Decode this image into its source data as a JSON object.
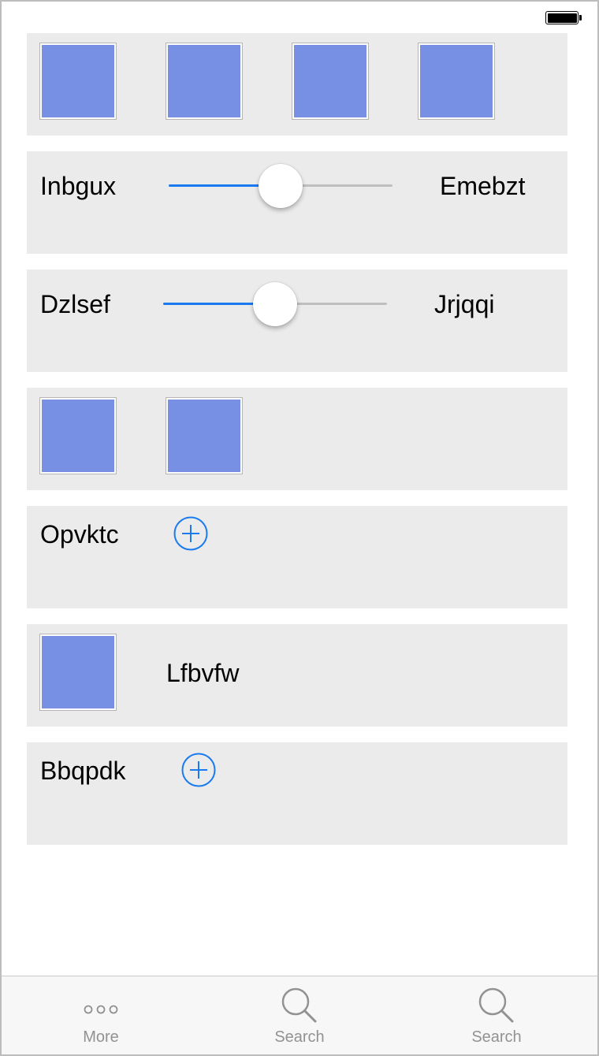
{
  "status_bar": {
    "battery_icon": "battery-full-icon"
  },
  "rows": {
    "row2": {
      "left_label": "Inbgux",
      "right_label": "Emebzt",
      "slider_value": 0.5
    },
    "row3": {
      "left_label": "Dzlsef",
      "right_label": "Jrjqqi",
      "slider_value": 0.5
    },
    "row5": {
      "label": "Opvktc",
      "button_icon": "plus-circle-icon"
    },
    "row6": {
      "label": "Lfbvfw"
    },
    "row7": {
      "label": "Bbqpdk",
      "button_icon": "plus-circle-icon"
    }
  },
  "colors": {
    "accent": "#1a7bf0",
    "thumbnail": "#7890e4",
    "card_background": "#ebebeb",
    "tab_inactive": "#929292"
  },
  "tabbar": {
    "tabs": [
      {
        "label": "More",
        "icon": "more-icon"
      },
      {
        "label": "Search",
        "icon": "search-icon"
      },
      {
        "label": "Search",
        "icon": "search-icon"
      }
    ]
  }
}
